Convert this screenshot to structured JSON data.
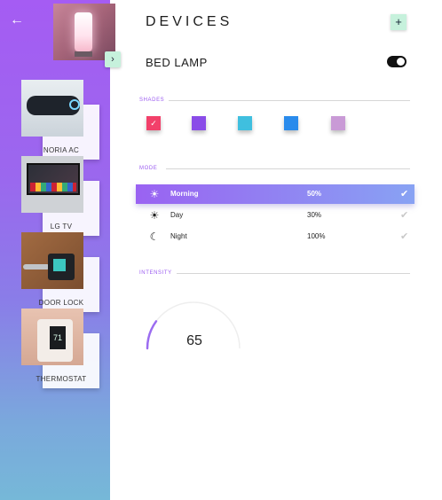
{
  "header": {
    "title": "DEVICES",
    "add_label": "+"
  },
  "nav": {
    "back_label": "←",
    "expand_label": "›"
  },
  "devices": [
    {
      "name": "NORIA AC"
    },
    {
      "name": "LG TV"
    },
    {
      "name": "DOOR LOCK"
    },
    {
      "name": "THERMOSTAT"
    }
  ],
  "thermostat_readout": "71",
  "selected_device": {
    "name": "BED LAMP",
    "power_on": true
  },
  "shades": {
    "label": "SHADES",
    "colors": [
      "#f2406a",
      "#8a4ce8",
      "#3fbfdf",
      "#2a8bec",
      "#c99ad6"
    ],
    "selected_index": 0,
    "check": "✓"
  },
  "mode": {
    "label": "MODE",
    "items": [
      {
        "name": "Morning",
        "value": "50%",
        "icon": "sunrise-icon",
        "glyph": "☀",
        "active": true
      },
      {
        "name": "Day",
        "value": "30%",
        "icon": "sun-icon",
        "glyph": "☀",
        "active": false
      },
      {
        "name": "Night",
        "value": "100%",
        "icon": "moon-icon",
        "glyph": "☾",
        "active": false
      }
    ],
    "check": "✔"
  },
  "intensity": {
    "label": "INTENSITY",
    "value": "65",
    "fraction": 0.2
  },
  "colors": {
    "accent": "#9b5cf0",
    "sidebar_top": "#a55cf3",
    "sidebar_bottom": "#76b8d8",
    "mint": "#c6f1dc"
  }
}
